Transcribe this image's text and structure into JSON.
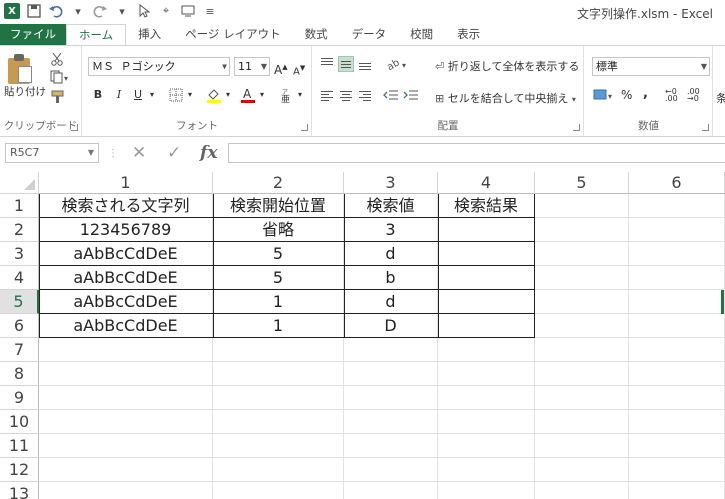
{
  "app": {
    "title": "文字列操作.xlsm - Excel",
    "logo": "X"
  },
  "qat": {
    "icons": [
      "save-icon",
      "undo-icon",
      "redo-icon",
      "select-icon",
      "cursor-icon",
      "screen-icon"
    ]
  },
  "tabs": [
    "ファイル",
    "ホーム",
    "挿入",
    "ページ レイアウト",
    "数式",
    "データ",
    "校閲",
    "表示"
  ],
  "ribbon": {
    "clipboard": {
      "paste": "貼り付け",
      "label": "クリップボード"
    },
    "font": {
      "name": "ＭＳ Ｐゴシック",
      "size": "11",
      "bold": "B",
      "italic": "I",
      "underline": "U",
      "grow": "A",
      "shrink": "A",
      "label": "フォント"
    },
    "alignment": {
      "wrap": "折り返して全体を表示する",
      "merge": "セルを結合して中央揃え",
      "label": "配置"
    },
    "number": {
      "format": "標準",
      "percent": "%",
      "comma": ",",
      "label": "数値"
    },
    "extra": "条"
  },
  "formula_bar": {
    "name_box": "R5C7",
    "cancel": "✕",
    "enter": "✓",
    "fx": "fx",
    "value": ""
  },
  "sheet": {
    "columns": [
      "1",
      "2",
      "3",
      "4",
      "5",
      "6"
    ],
    "rows": [
      "1",
      "2",
      "3",
      "4",
      "5",
      "6",
      "7",
      "8",
      "9",
      "10",
      "11",
      "12",
      "13"
    ],
    "selected_row": "5",
    "cells": [
      [
        "検索される文字列",
        "検索開始位置",
        "検索値",
        "検索結果"
      ],
      [
        "123456789",
        "省略",
        "3",
        ""
      ],
      [
        "aAbBcCdDeE",
        "5",
        "d",
        ""
      ],
      [
        "aAbBcCdDeE",
        "5",
        "b",
        ""
      ],
      [
        "aAbBcCdDeE",
        "1",
        "d",
        ""
      ],
      [
        "aAbBcCdDeE",
        "1",
        "D",
        ""
      ]
    ]
  },
  "colors": {
    "accent": "#217346",
    "grid_line": "#e2e2e2",
    "table_border": "#222222"
  }
}
